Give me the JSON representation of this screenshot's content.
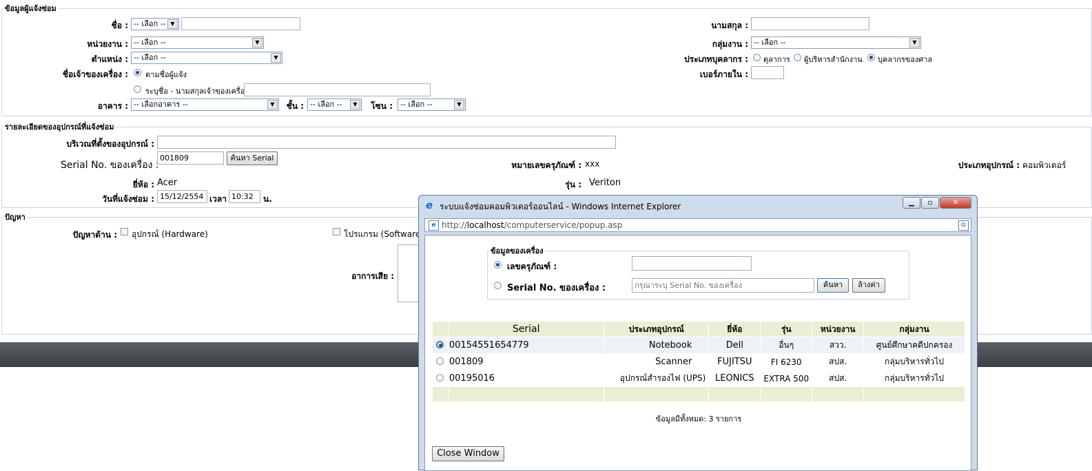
{
  "reporter": {
    "legend": "ข้อมูลผู้แจ้งซ่อม",
    "name_label": "ชื่อ :",
    "name_select": "-- เลือก --",
    "surname_label": "นามสกุล :",
    "unit_label": "หน่วยงาน :",
    "unit_select": "-- เลือก --",
    "group_label": "กลุ่มงาน :",
    "group_select": "-- เลือก --",
    "position_label": "ตำแหน่ง :",
    "position_select": "-- เลือก --",
    "personnel_type_label": "ประเภทบุคลากร :",
    "personnel_types": [
      "ตุลาการ",
      "ผู้บริหารสำนักงาน",
      "บุคลากรของศาล"
    ],
    "owner_label": "ชื่อเจ้าของเครื่อง :",
    "owner_option_1": "ตามชื่อผู้แจ้ง",
    "owner_option_2": "ระบุชื่อ - นามสกุลเจ้าของเครื่อง",
    "ext_label": "เบอร์ภายใน :",
    "building_label": "อาคาร :",
    "building_select": "-- เลือกอาคาร --",
    "floor_label": "ชั้น :",
    "floor_select": "-- เลือก --",
    "zone_label": "โซน :",
    "zone_select": "-- เลือก --"
  },
  "device": {
    "legend": "รายละเอียดของอุปกรณ์ที่แจ้งซ่อม",
    "location_label": "บริเวณที่ตั้งของอุปกรณ์ :",
    "serial_label": "Serial No. ของเครื่อง :",
    "serial_value": "001809",
    "serial_button": "ค้นหา Serial",
    "asset_label": "หมายเลขครุภัณฑ์ :",
    "asset_value": "xxx",
    "type_label": "ประเภทอุปกรณ์ :",
    "type_value": "คอมพิวเตอร์",
    "brand_label": "ยี่ห้อ :",
    "brand_value": "Acer",
    "model_label": "รุ่น :",
    "model_value": "Veriton",
    "date_label": "วันที่แจ้งซ่อม :",
    "date_value": "15/12/2554",
    "time_label": "เวลา",
    "time_value": "10:32",
    "time_unit": "น."
  },
  "problem": {
    "legend": "ปัญหา",
    "side_label": "ปัญหาด้าน :",
    "hardware": "อุปกรณ์ (Hardware)",
    "software": "โปรแกรม (Software)",
    "symptom_label": "อาการเสีย :"
  },
  "popup": {
    "title": "ระบบแจ้งซ่อมคอมพิวเตอร์ออนไลน์ - Windows Internet Explorer",
    "url_prefix": "http://",
    "url_host": "localhost",
    "url_path": "/computerservice/popup.asp",
    "search_legend": "ข้อมูลของเครื่อง",
    "asset_option": "เลขครุภัณฑ์ :",
    "serial_option": "Serial No. ของเครื่อง :",
    "serial_placeholder": "กรุณาระบุ Serial No. ของเครื่อง",
    "search_button": "ค้นหา",
    "clear_button": "ล้างค่า",
    "columns": [
      "Serial",
      "ประเภทอุปกรณ์",
      "ยี่ห้อ",
      "รุ่น",
      "หน่วยงาน",
      "กลุ่มงาน"
    ],
    "rows": [
      {
        "serial": "00154551654779",
        "type": "Notebook",
        "brand": "Dell",
        "model": "อื่นๆ",
        "unit": "สวว.",
        "group": "ศูนย์ศึกษาคดีปกครอง"
      },
      {
        "serial": "001809",
        "type": "Scanner",
        "brand": "FUJITSU",
        "model": "FI 6230",
        "unit": "สปส.",
        "group": "กลุ่มบริหารทั่วไป"
      },
      {
        "serial": "00195016",
        "type": "อุปกรณ์สำรองไฟ (UPS)",
        "brand": "LEONICS",
        "model": "EXTRA 500",
        "unit": "สปส.",
        "group": "กลุ่มบริหารทั่วไป"
      }
    ],
    "total_text": "ข้อมูลมีทั้งหมด: 3 รายการ",
    "close_button": "Close Window"
  },
  "colors": {
    "header_bg": "#ecedd5",
    "fieldset_border": "#c9d3e0",
    "footer_bar": "#4a5055"
  }
}
